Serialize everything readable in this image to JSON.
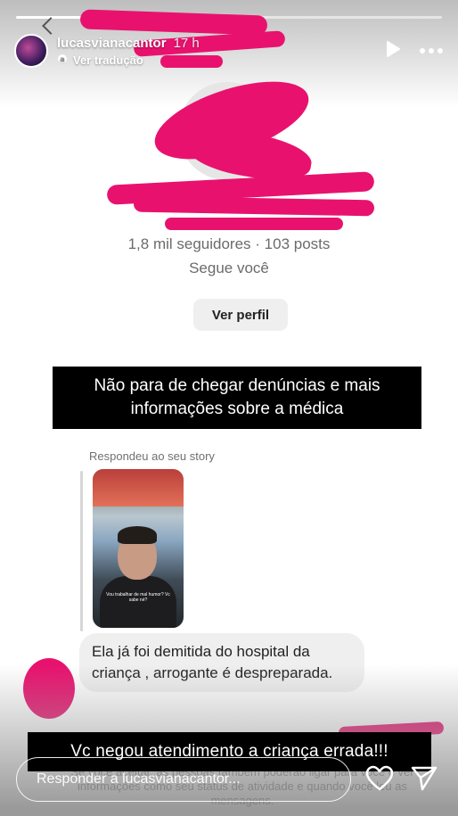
{
  "header": {
    "username": "lucasvianacantor",
    "time": "17 h",
    "translate_label": "Ver tradução"
  },
  "profile": {
    "stats": "1,8 mil seguidores · 103 posts",
    "follows_you": "Segue você",
    "view_profile_label": "Ver perfil"
  },
  "captions": {
    "top": "Não para de chegar denúncias e mais informações sobre a médica",
    "bottom": "Vc negou atendimento a criança errada!!!"
  },
  "reply": {
    "label": "Respondeu ao seu story",
    "story_caption": "Vou trabalhar de mal humor? Vc sabe né?",
    "message": "Ela já foi demitida do hospital da criança , arrogante é despreparada."
  },
  "background_notice": "Se você aceitar, as pessoas também poderão ligar para você e ver informações como seu status de atividade e quando você leu as mensagens.",
  "composer": {
    "placeholder": "Responder a lucasvianacantor..."
  },
  "colors": {
    "redaction": "#e8126e",
    "caption_bg": "#000000",
    "bubble_bg": "#efefef"
  },
  "icons": [
    "back-icon",
    "translate-icon",
    "play-icon",
    "more-icon",
    "heart-icon",
    "send-icon"
  ]
}
